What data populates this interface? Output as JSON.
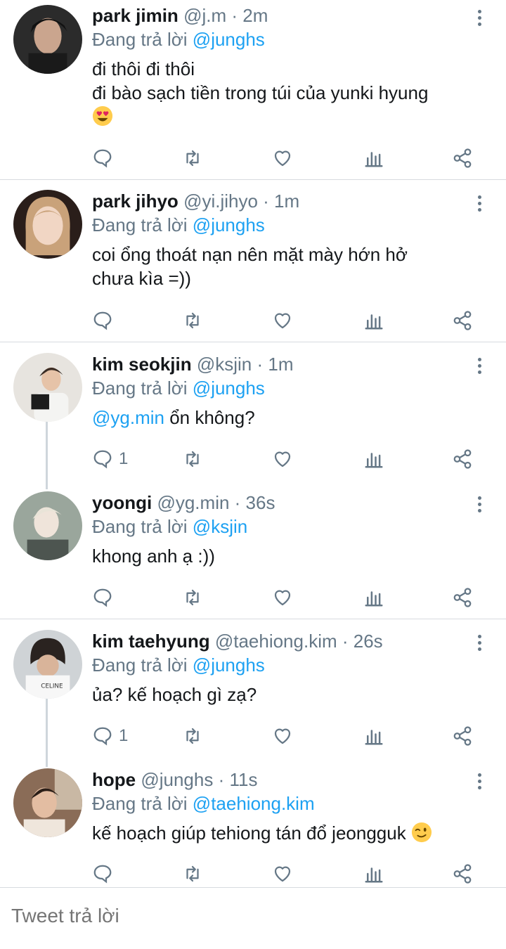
{
  "tweets": [
    {
      "name": "park jimin",
      "handle": "@j.m",
      "time": "2m",
      "reply_prefix": "Đang trả lời",
      "reply_to": "@junghs",
      "text_lines": [
        "đi thôi đi thôi",
        "đi bào sạch tiền trong túi của yunki hyung"
      ],
      "emoji": "heart-eyes-emoji",
      "reply_count": ""
    },
    {
      "name": "park jihyo",
      "handle": "@yi.jihyo",
      "time": "1m",
      "reply_prefix": "Đang trả lời",
      "reply_to": "@junghs",
      "text_lines": [
        "coi ổng thoát nạn nên mặt mày hớn hở",
        "chưa kìa =))"
      ],
      "reply_count": ""
    },
    {
      "name": "kim seokjin",
      "handle": "@ksjin",
      "time": "1m",
      "reply_prefix": "Đang trả lời",
      "reply_to": "@junghs",
      "mention": "@yg.min",
      "text_rest": " ổn không?",
      "reply_count": "1"
    },
    {
      "name": "yoongi",
      "handle": "@yg.min",
      "time": "36s",
      "reply_prefix": "Đang trả lời",
      "reply_to": "@ksjin",
      "text_lines": [
        "khong anh ạ :))"
      ],
      "reply_count": ""
    },
    {
      "name": "kim taehyung",
      "handle": "@taehiong.kim",
      "time": "26s",
      "reply_prefix": "Đang trả lời",
      "reply_to": "@junghs",
      "text_lines": [
        "ủa? kế hoạch gì zạ?"
      ],
      "reply_count": "1"
    },
    {
      "name": "hope",
      "handle": "@junghs",
      "time": "11s",
      "reply_prefix": "Đang trả lời",
      "reply_to": "@taehiong.kim",
      "text_lines": [
        "kế hoạch giúp tehiong tán đổ jeongguk"
      ],
      "emoji": "wink-emoji",
      "reply_count": ""
    }
  ],
  "separator": " · ",
  "compose": {
    "placeholder": "Tweet trả lời"
  },
  "colors": {
    "link": "#1da1f2",
    "muted": "#657786",
    "divider": "#d7dbdf"
  },
  "icons": [
    "reply-icon",
    "retweet-icon",
    "like-icon",
    "views-icon",
    "share-icon",
    "more-icon"
  ]
}
